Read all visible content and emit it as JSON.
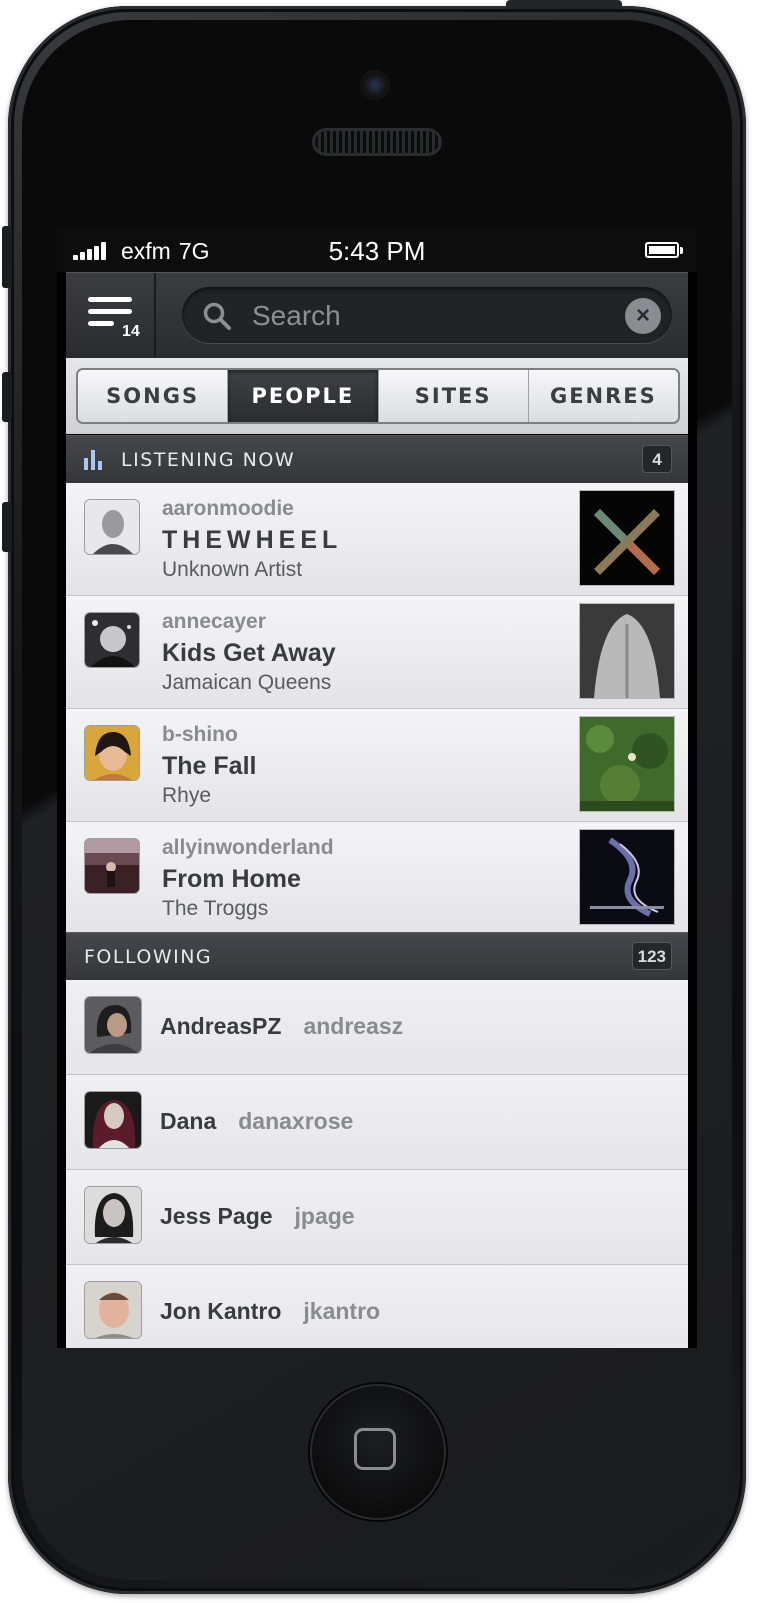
{
  "status_bar": {
    "carrier": "exfm",
    "network": "7G",
    "time": "5:43 PM"
  },
  "toolbar": {
    "menu_count": "14",
    "search_placeholder": "Search"
  },
  "tabs": [
    {
      "label": "SONGS",
      "active": false
    },
    {
      "label": "PEOPLE",
      "active": true
    },
    {
      "label": "SITES",
      "active": false
    },
    {
      "label": "GENRES",
      "active": false
    }
  ],
  "listening_now": {
    "title": "LISTENING NOW",
    "count": "4",
    "items": [
      {
        "username": "aaronmoodie",
        "track": "THEWHEEL",
        "artist": "Unknown Artist"
      },
      {
        "username": "annecayer",
        "track": "Kids Get Away",
        "artist": "Jamaican Queens"
      },
      {
        "username": "b-shino",
        "track": "The Fall",
        "artist": "Rhye"
      },
      {
        "username": "allyinwonderland",
        "track": "From Home",
        "artist": "The Troggs"
      }
    ]
  },
  "following": {
    "title": "FOLLOWING",
    "count": "123",
    "items": [
      {
        "name": "AndreasPZ",
        "handle": "andreasz"
      },
      {
        "name": "Dana",
        "handle": "danaxrose"
      },
      {
        "name": "Jess Page",
        "handle": "jpage"
      },
      {
        "name": "Jon Kantro",
        "handle": "jkantro"
      }
    ]
  },
  "colors": {
    "accent_icon": "#a9c7ef",
    "header_bg": "#3b3c40",
    "row_bg": "#f0f0f3"
  }
}
